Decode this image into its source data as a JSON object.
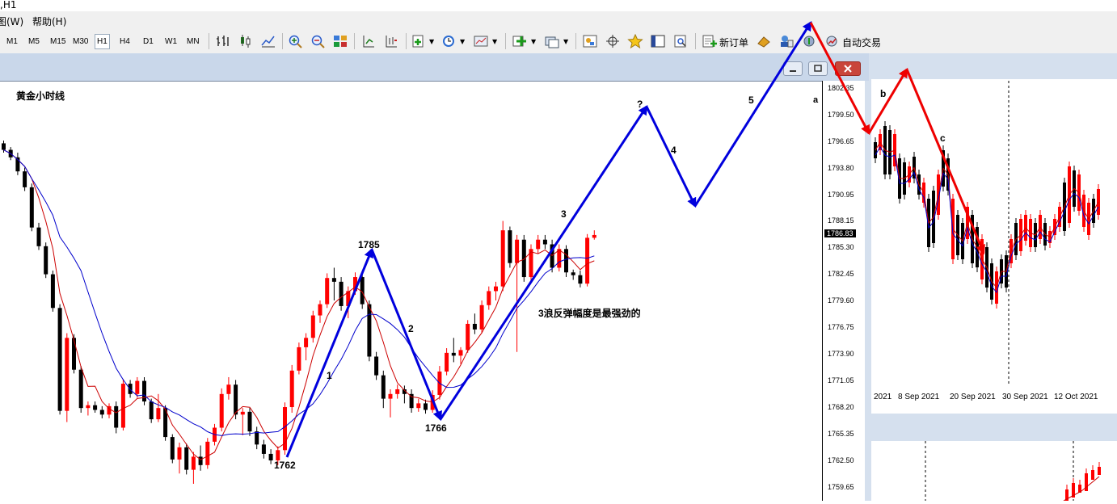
{
  "window": {
    "title": ",H1"
  },
  "menu": {
    "items": [
      "图(W)",
      "帮助(H)"
    ]
  },
  "toolbar": {
    "timeframes": [
      "M1",
      "M5",
      "M15",
      "M30",
      "H1",
      "H4",
      "D1",
      "W1",
      "MN"
    ],
    "active_timeframe": "H1",
    "new_order_label": "新订单",
    "auto_trade_label": "自动交易",
    "icons": [
      "bar-chart-icon",
      "candlestick-icon",
      "line-chart-icon",
      "zoom-in-icon",
      "zoom-out-icon",
      "tile-windows-icon",
      "auto-scroll-icon",
      "chart-shift-icon",
      "indicators-icon",
      "periods-icon",
      "templates-icon",
      "new-chart-icon",
      "profiles-icon",
      "navigator-icon",
      "crosshair-icon",
      "favorites-icon",
      "data-window-icon",
      "strategy-tester-icon",
      "new-order-icon",
      "market-watch-icon",
      "terminal-icon",
      "signals-icon",
      "auto-trading-icon"
    ]
  },
  "main_chart": {
    "symbol_label": "黄金小时线",
    "price_ticks": [
      "1802.35",
      "1799.50",
      "1796.65",
      "1793.80",
      "1790.95",
      "1788.15",
      "1785.30",
      "1782.45",
      "1779.60",
      "1776.75",
      "1773.90",
      "1771.05",
      "1768.20",
      "1765.35",
      "1762.50",
      "1759.65"
    ],
    "current_price": "1786.83",
    "annotations": {
      "low1": "1762",
      "high1": "1785",
      "low2": "1766",
      "wave1": "1",
      "wave2": "2",
      "wave3": "3",
      "wave4": "4",
      "wave5": "5",
      "question": "?",
      "note": "3浪反弹幅度是最强劲的",
      "a": "a"
    },
    "colors": {
      "up": "#ff0000",
      "down": "#000000",
      "ma_fast": "#cc0000",
      "ma_slow": "#0000cc",
      "wave_arrow": "#0000dd"
    }
  },
  "right_chart": {
    "dates": [
      "2021",
      "8 Sep 2021",
      "20 Sep 2021",
      "30 Sep 2021",
      "12 Oct 2021"
    ],
    "labels": {
      "b": "b",
      "c": "c"
    },
    "colors": {
      "wave_arrow": "#ee0000"
    }
  },
  "chart_data": {
    "type": "candlestick",
    "title": "黄金小时线",
    "ylim": [
      1758.3,
      1803.2
    ],
    "ohlc": [
      [
        1796.6,
        1796.9,
        1795.6,
        1795.9
      ],
      [
        1795.9,
        1796.2,
        1794.8,
        1795.1
      ],
      [
        1795.1,
        1795.6,
        1793.2,
        1793.6
      ],
      [
        1793.6,
        1794.0,
        1791.5,
        1791.9
      ],
      [
        1791.9,
        1792.3,
        1787.2,
        1787.6
      ],
      [
        1787.6,
        1788.1,
        1785.2,
        1785.6
      ],
      [
        1785.6,
        1786.0,
        1782.2,
        1782.6
      ],
      [
        1782.6,
        1783.0,
        1778.6,
        1779.0
      ],
      [
        1779.0,
        1779.4,
        1767.6,
        1768.0
      ],
      [
        1768.0,
        1776.3,
        1766.8,
        1775.8
      ],
      [
        1775.8,
        1776.2,
        1772.0,
        1772.4
      ],
      [
        1772.4,
        1772.8,
        1767.8,
        1768.3
      ],
      [
        1768.3,
        1769.0,
        1767.5,
        1768.6
      ],
      [
        1768.6,
        1769.0,
        1767.8,
        1768.1
      ],
      [
        1768.1,
        1768.5,
        1767.2,
        1767.6
      ],
      [
        1767.6,
        1768.8,
        1767.2,
        1768.5
      ],
      [
        1768.5,
        1769.0,
        1765.6,
        1766.2
      ],
      [
        1766.2,
        1771.4,
        1765.9,
        1770.9
      ],
      [
        1770.9,
        1771.3,
        1769.4,
        1769.8
      ],
      [
        1769.8,
        1771.6,
        1769.4,
        1771.2
      ],
      [
        1771.2,
        1771.6,
        1768.6,
        1769.0
      ],
      [
        1769.0,
        1769.3,
        1766.7,
        1767.1
      ],
      [
        1767.1,
        1769.8,
        1766.8,
        1768.3
      ],
      [
        1768.3,
        1768.6,
        1764.8,
        1765.2
      ],
      [
        1765.2,
        1765.5,
        1762.4,
        1762.8
      ],
      [
        1762.8,
        1764.6,
        1761.3,
        1764.1
      ],
      [
        1764.1,
        1764.5,
        1761.2,
        1761.7
      ],
      [
        1761.7,
        1763.6,
        1760.2,
        1763.1
      ],
      [
        1763.1,
        1764.3,
        1761.6,
        1762.2
      ],
      [
        1762.2,
        1765.1,
        1761.8,
        1764.7
      ],
      [
        1764.7,
        1766.6,
        1764.3,
        1766.2
      ],
      [
        1766.2,
        1770.4,
        1765.8,
        1769.8
      ],
      [
        1769.8,
        1771.6,
        1769.2,
        1770.8
      ],
      [
        1770.8,
        1771.3,
        1767.1,
        1767.6
      ],
      [
        1767.6,
        1768.3,
        1765.4,
        1767.9
      ],
      [
        1767.9,
        1768.3,
        1765.3,
        1765.8
      ],
      [
        1765.8,
        1766.3,
        1763.9,
        1764.4
      ],
      [
        1764.4,
        1764.9,
        1762.9,
        1763.4
      ],
      [
        1763.4,
        1763.9,
        1762.3,
        1762.7
      ],
      [
        1762.7,
        1764.2,
        1762.2,
        1763.8
      ],
      [
        1763.8,
        1768.9,
        1763.3,
        1768.4
      ],
      [
        1768.4,
        1772.9,
        1767.8,
        1772.3
      ],
      [
        1772.3,
        1775.3,
        1771.9,
        1774.8
      ],
      [
        1774.8,
        1776.3,
        1773.4,
        1775.8
      ],
      [
        1775.8,
        1778.7,
        1775.3,
        1778.2
      ],
      [
        1778.2,
        1779.8,
        1777.4,
        1779.4
      ],
      [
        1779.4,
        1782.7,
        1779.0,
        1782.2
      ],
      [
        1782.2,
        1783.3,
        1779.8,
        1781.8
      ],
      [
        1781.8,
        1782.3,
        1778.7,
        1779.2
      ],
      [
        1779.2,
        1781.3,
        1777.9,
        1780.8
      ],
      [
        1780.8,
        1782.8,
        1780.4,
        1782.3
      ],
      [
        1782.3,
        1782.8,
        1778.9,
        1779.4
      ],
      [
        1779.4,
        1779.8,
        1773.3,
        1773.8
      ],
      [
        1773.8,
        1774.3,
        1771.3,
        1771.8
      ],
      [
        1771.8,
        1772.3,
        1768.3,
        1769.3
      ],
      [
        1769.3,
        1770.3,
        1767.3,
        1769.8
      ],
      [
        1769.8,
        1770.8,
        1769.3,
        1770.3
      ],
      [
        1770.3,
        1770.7,
        1768.8,
        1769.8
      ],
      [
        1769.8,
        1770.3,
        1767.8,
        1768.3
      ],
      [
        1768.3,
        1769.3,
        1767.9,
        1768.8
      ],
      [
        1768.8,
        1769.2,
        1767.7,
        1768.1
      ],
      [
        1768.1,
        1770.2,
        1767.8,
        1769.7
      ],
      [
        1769.7,
        1772.8,
        1769.2,
        1772.2
      ],
      [
        1772.2,
        1774.7,
        1771.8,
        1774.2
      ],
      [
        1774.2,
        1775.8,
        1773.2,
        1773.9
      ],
      [
        1773.9,
        1774.8,
        1773.0,
        1774.5
      ],
      [
        1774.5,
        1777.7,
        1774.2,
        1777.3
      ],
      [
        1777.3,
        1778.4,
        1776.2,
        1776.7
      ],
      [
        1776.7,
        1779.8,
        1776.3,
        1779.3
      ],
      [
        1779.3,
        1781.3,
        1778.8,
        1780.8
      ],
      [
        1780.8,
        1781.8,
        1779.8,
        1781.3
      ],
      [
        1781.3,
        1788.3,
        1780.8,
        1787.3
      ],
      [
        1787.3,
        1787.7,
        1783.3,
        1783.8
      ],
      [
        1783.8,
        1786.8,
        1774.3,
        1786.3
      ],
      [
        1786.3,
        1786.8,
        1781.8,
        1782.3
      ],
      [
        1782.3,
        1785.8,
        1781.8,
        1785.3
      ],
      [
        1785.3,
        1786.8,
        1784.8,
        1786.3
      ],
      [
        1786.3,
        1786.8,
        1785.3,
        1785.8
      ],
      [
        1785.8,
        1786.3,
        1782.8,
        1783.3
      ],
      [
        1783.3,
        1785.8,
        1782.9,
        1785.3
      ],
      [
        1785.3,
        1785.7,
        1782.3,
        1782.8
      ],
      [
        1782.8,
        1783.1,
        1782.0,
        1782.5
      ],
      [
        1782.5,
        1783.0,
        1781.2,
        1781.6
      ],
      [
        1781.6,
        1786.9,
        1781.3,
        1786.5
      ],
      [
        1786.5,
        1787.3,
        1786.3,
        1786.8
      ]
    ],
    "wave_projection": [
      {
        "label": "1762",
        "price": 1762
      },
      {
        "label": "1785",
        "price": 1785
      },
      {
        "label": "1766",
        "price": 1766
      },
      {
        "label": "?",
        "price": 1800
      }
    ]
  }
}
